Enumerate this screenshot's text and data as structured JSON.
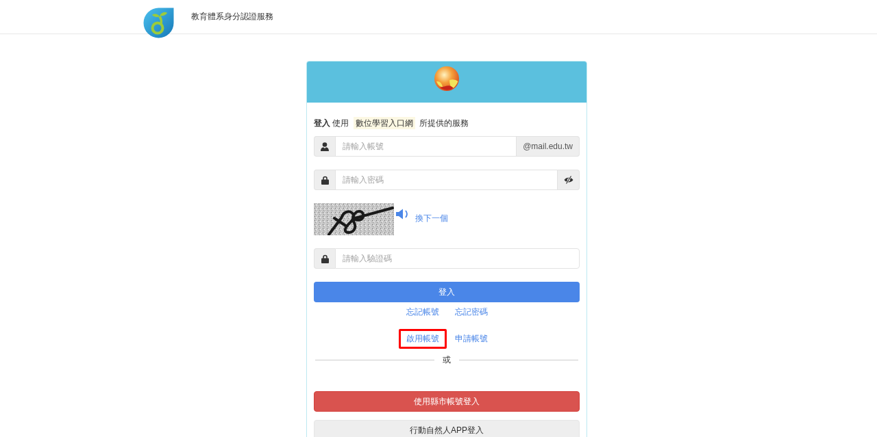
{
  "header": {
    "title": "教育體系身分認證服務"
  },
  "card": {
    "intro": [
      {
        "kind": "bold",
        "text": "登入"
      },
      {
        "kind": "plain",
        "text": "使用"
      },
      {
        "kind": "highlight",
        "text": "數位學習入口網"
      },
      {
        "kind": "plain",
        "text": "所提供的服務"
      }
    ],
    "form": [
      {
        "kind": "account",
        "placeholder": "請輸入帳號",
        "suffix": "@mail.edu.tw"
      },
      {
        "kind": "password",
        "placeholder": "請輸入密碼"
      },
      {
        "kind": "captcha",
        "refresh_link": "換下一個"
      },
      {
        "kind": "code",
        "placeholder": "請輸入驗證碼"
      }
    ],
    "login_button": "登入",
    "link_rows": [
      {
        "links": [
          {
            "label": "忘記帳號",
            "highlighted": false
          },
          {
            "label": "忘記密碼",
            "highlighted": false
          }
        ]
      },
      {
        "links": [
          {
            "label": "啟用帳號",
            "highlighted": true
          },
          {
            "label": "申請帳號",
            "highlighted": false
          }
        ]
      }
    ],
    "divider": "或",
    "alt_buttons": [
      {
        "kind": "danger",
        "label": "使用縣市帳號登入"
      },
      {
        "kind": "default",
        "label": "行動自然人APP登入"
      }
    ]
  }
}
